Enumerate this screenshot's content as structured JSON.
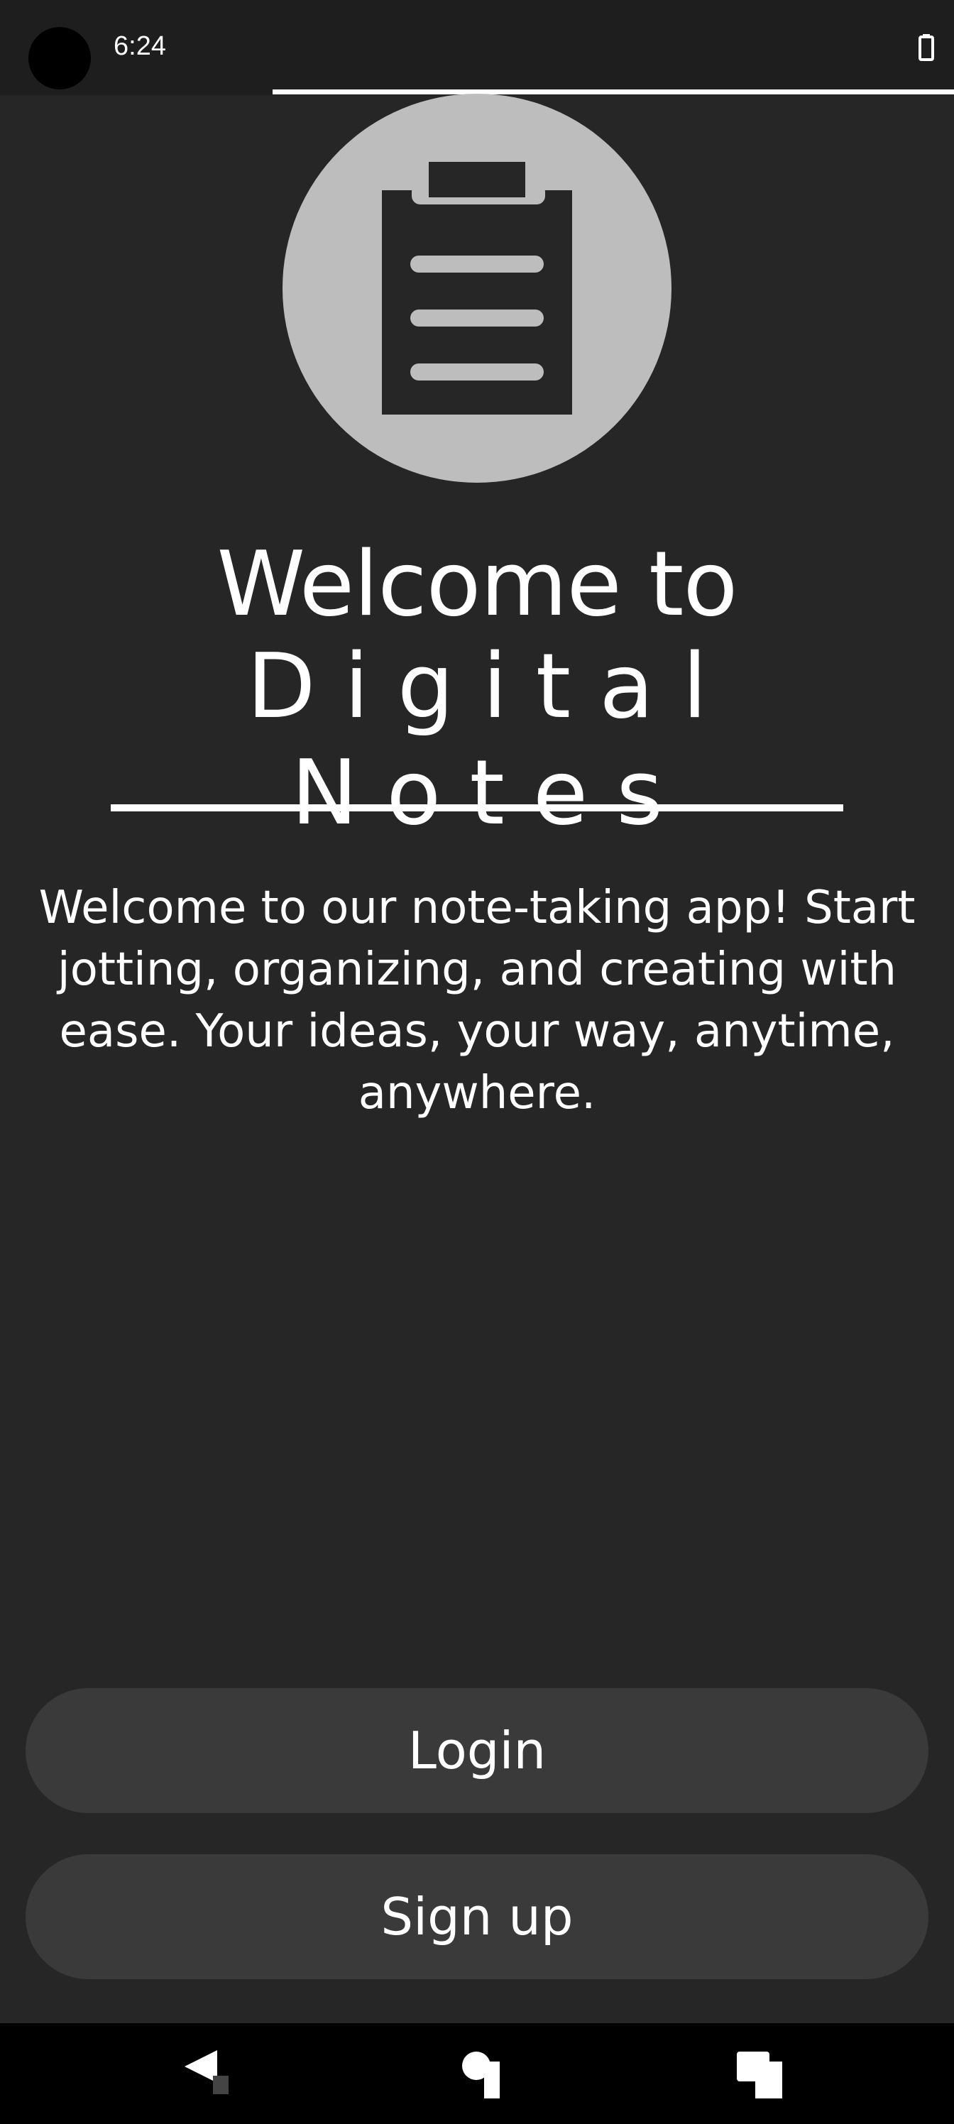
{
  "status_bar": {
    "time": "6:24"
  },
  "logo": {
    "icon": "clipboard-icon"
  },
  "welcome": {
    "title_line1": "Welcome to",
    "title_line2": "Digital Notes",
    "description": "Welcome to our note-taking app! Start jotting, organizing, and creating with ease. Your ideas, your way, anytime, anywhere."
  },
  "actions": {
    "login_label": "Login",
    "signup_label": "Sign up"
  },
  "nav": {
    "back_icon": "back-icon",
    "home_icon": "home-icon",
    "recents_icon": "recents-icon"
  },
  "colors": {
    "background": "#262626",
    "button": "#3a3a3a",
    "logo_circle": "#bdbdbd",
    "text": "#ffffff"
  }
}
